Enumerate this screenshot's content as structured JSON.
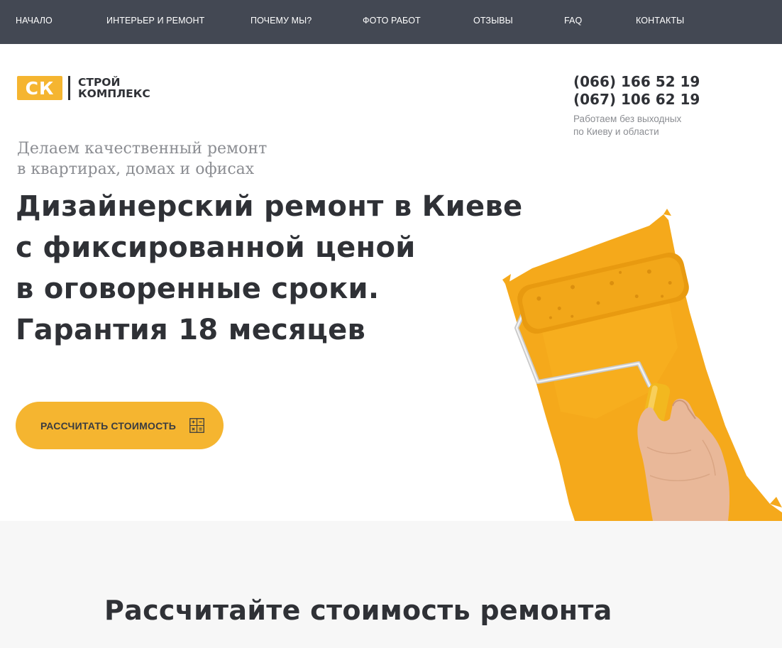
{
  "nav": {
    "items": [
      {
        "label": "НАЧАЛО"
      },
      {
        "label": "ИНТЕРЬЕР И РЕМОНТ"
      },
      {
        "label": "ПОЧЕМУ МЫ?"
      },
      {
        "label": "ФОТО РАБОТ"
      },
      {
        "label": "ОТЗЫВЫ"
      },
      {
        "label": "FAQ"
      },
      {
        "label": "КОНТАКТЫ"
      }
    ]
  },
  "header": {
    "logo": {
      "badge": "СК",
      "line1": "СТРОЙ",
      "line2": "КОМПЛЕКС"
    },
    "phones": [
      "(066) 166 52 19",
      "(067) 106 62 19"
    ],
    "work_hours": "Работаем без выходных по Киеву и области"
  },
  "hero": {
    "tagline": [
      "Делаем качественный ремонт",
      "в квартирах, домах и офисах"
    ],
    "headline": [
      "Дизайнерский ремонт в Киеве",
      "с фиксированной ценой",
      "в оговоренные сроки.",
      "Гарантия 18 месяцев"
    ],
    "cta_label": "РАССЧИТАТЬ СТОИМОСТЬ",
    "cta_icon": "calculator-icon",
    "image": "paint-roller-illustration"
  },
  "section2": {
    "title": "Рассчитайте стоимость ремонта"
  },
  "colors": {
    "nav_bg": "#434853",
    "accent": "#f5b530",
    "text_dark": "#2f3136",
    "text_muted": "#8b8d92",
    "section_bg": "#f7f7f7"
  }
}
